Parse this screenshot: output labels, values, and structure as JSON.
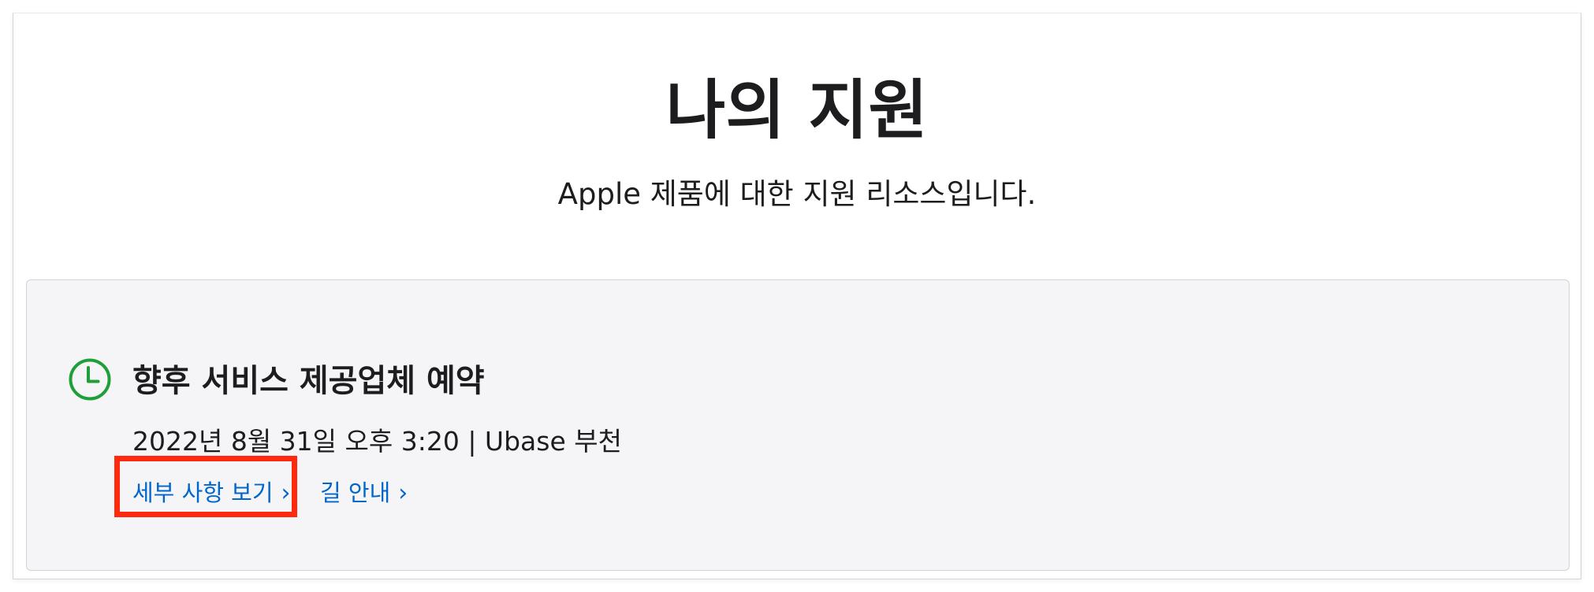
{
  "header": {
    "title": "나의 지원",
    "subtitle": "Apple 제품에 대한 지원 리소스입니다."
  },
  "appointment_card": {
    "icon": "clock-icon",
    "icon_color": "#1f9e3a",
    "title": "향후 서비스 제공업체 예약",
    "details": "2022년 8월 31일 오후 3:20 | Ubase 부천",
    "links": {
      "view_details": "세부 사항 보기",
      "directions": "길 안내",
      "chevron": "›"
    },
    "link_color": "#0066cc",
    "highlight_color": "#ff2a0e"
  }
}
